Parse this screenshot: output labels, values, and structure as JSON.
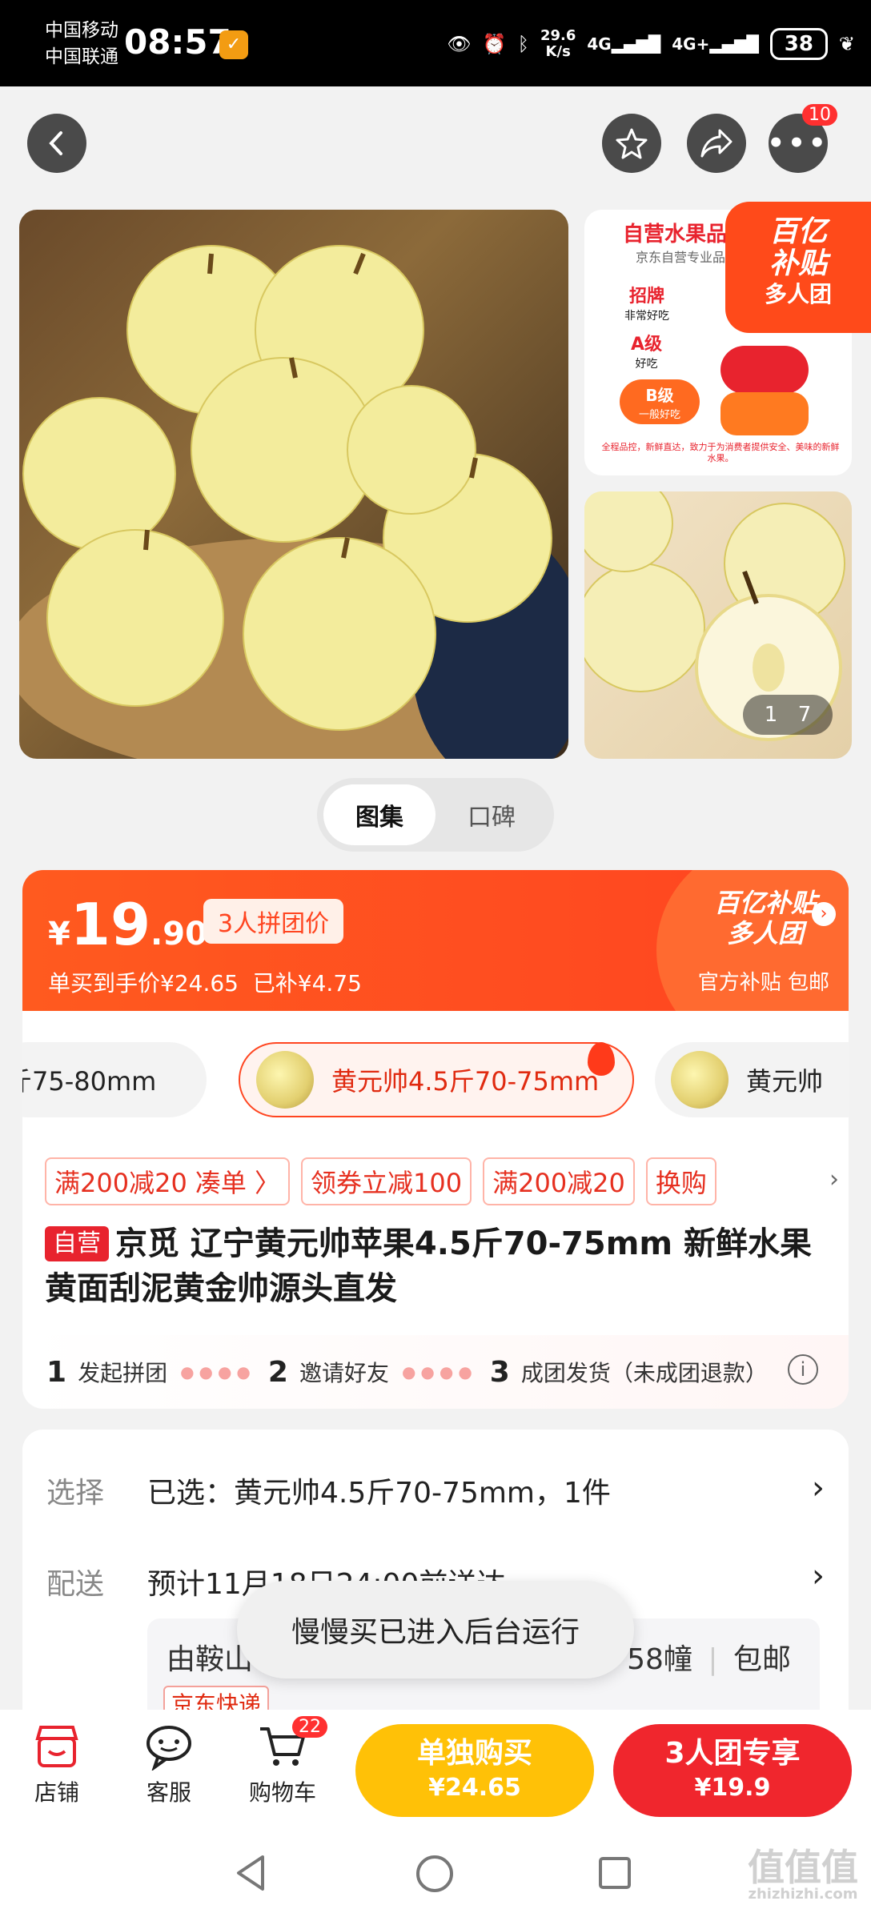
{
  "status_bar": {
    "carrier1": "中国移动",
    "carrier2": "中国联通",
    "time": "08:57",
    "speed_value": "29.6",
    "speed_unit": "K/s",
    "signal1": "4G",
    "signal2": "4G+",
    "battery": "38"
  },
  "nav": {
    "more_badge": "10"
  },
  "gallery": {
    "side_header": "自营水果品",
    "side_sub": "京东自营专业品",
    "grades": [
      "招牌",
      "非常好吃",
      "A级",
      "好吃",
      "B级",
      "一般好吃"
    ],
    "side_footer": "全程品控，新鲜直达，致力于为消费者提供安全、美味的新鲜水果。",
    "promo_line1": "百亿",
    "promo_line2": "补贴",
    "promo_line3": "多人团",
    "counter_current": "1",
    "counter_total": "7"
  },
  "tabs": [
    {
      "label": "图集",
      "active": true
    },
    {
      "label": "口碑",
      "active": false
    }
  ],
  "price": {
    "currency": "¥",
    "integer": "19",
    "decimal": ".90",
    "group_badge": "3人拼团价",
    "single_price": "单买到手价¥24.65",
    "subsidized": "已补¥4.75",
    "subsidy_title1": "百亿补贴",
    "subsidy_title2": "多人团",
    "subsidy_sub": "官方补贴 包邮"
  },
  "variants": [
    {
      "label": "斤75-80mm",
      "selected": false
    },
    {
      "label": "黄元帅4.5斤70-75mm",
      "selected": true
    },
    {
      "label": "黄元帅",
      "selected": false
    }
  ],
  "coupons": [
    "满200减20",
    "凑单 〉",
    "领券立减100",
    "满200减20",
    "换购"
  ],
  "product": {
    "self_tag": "自营",
    "title": "京觅 辽宁黄元帅苹果4.5斤70-75mm 新鲜水果黄面刮泥黄金帅源头直发"
  },
  "steps": [
    {
      "num": "1",
      "label": "发起拼团"
    },
    {
      "num": "2",
      "label": "邀请好友"
    },
    {
      "num": "3",
      "label": "成团发货（未成团退款）"
    }
  ],
  "options": {
    "select_label": "选择",
    "select_value": "已选：黄元帅4.5斤70-75mm，1件",
    "ship_label": "配送",
    "ship_value": "预计11月18日24:00前送达",
    "ship_from": "由鞍山",
    "ship_mid": "58幢",
    "ship_free": "包邮",
    "express": "京东快递"
  },
  "toast": "慢慢买已进入后台运行",
  "bottom_bar": {
    "shop": "店铺",
    "service": "客服",
    "cart": "购物车",
    "cart_badge": "22",
    "buy_single_title": "单独购买",
    "buy_single_price": "¥24.65",
    "buy_group_title": "3人团专享",
    "buy_group_price": "¥19.9"
  },
  "watermark": {
    "main": "值值值",
    "sub": "zhizhizhi.com"
  },
  "colors": {
    "accent": "#ff4520",
    "single_buy": "#ffc107",
    "group_buy": "#f0262d"
  }
}
